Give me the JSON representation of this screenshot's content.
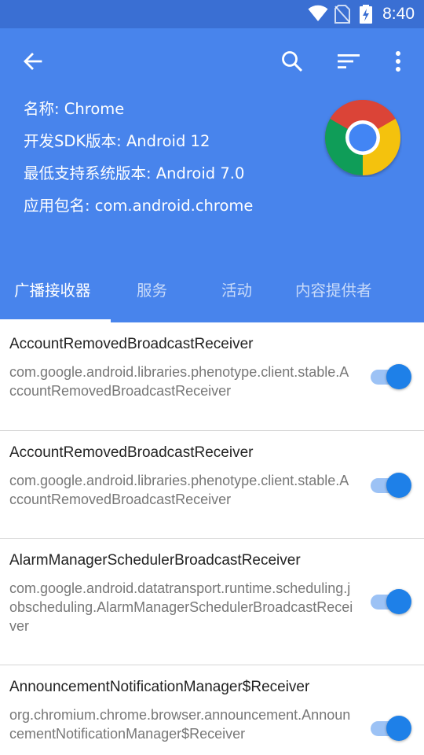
{
  "status_bar": {
    "time": "8:40"
  },
  "header": {
    "app_name_line": "名称: Chrome",
    "target_sdk_line": "开发SDK版本: Android 12",
    "min_sdk_line": "最低支持系统版本: Android 7.0",
    "package_line": "应用包名: com.android.chrome"
  },
  "tabs": [
    {
      "label": "广播接收器",
      "active": true
    },
    {
      "label": "服务",
      "active": false
    },
    {
      "label": "活动",
      "active": false
    },
    {
      "label": "内容提供者",
      "active": false
    }
  ],
  "receivers": [
    {
      "name": "AccountRemovedBroadcastReceiver",
      "class": "com.google.android.libraries.phenotype.client.stable.AccountRemovedBroadcastReceiver",
      "enabled": true
    },
    {
      "name": "AccountRemovedBroadcastReceiver",
      "class": "com.google.android.libraries.phenotype.client.stable.AccountRemovedBroadcastReceiver",
      "enabled": true
    },
    {
      "name": "AlarmManagerSchedulerBroadcastReceiver",
      "class": "com.google.android.datatransport.runtime.scheduling.jobscheduling.AlarmManagerSchedulerBroadcastReceiver",
      "enabled": true
    },
    {
      "name": "AnnouncementNotificationManager$Receiver",
      "class": "org.chromium.chrome.browser.announcement.AnnouncementNotificationManager$Receiver",
      "enabled": true
    }
  ],
  "colors": {
    "status_bar": "#3a6fd3",
    "header": "#4884ec",
    "switch_thumb": "#1e80e8",
    "switch_track": "#9cc2f5"
  }
}
